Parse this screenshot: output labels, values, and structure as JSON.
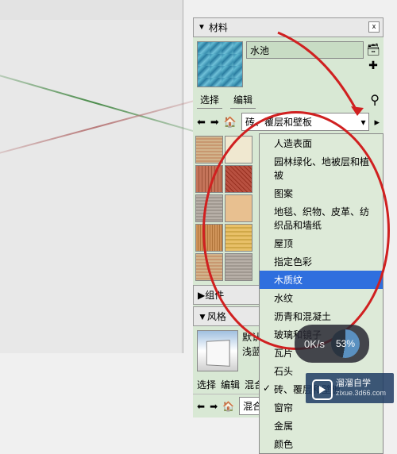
{
  "panel": {
    "title": "材料",
    "material_name": "水池",
    "tabs": {
      "select": "选择",
      "edit": "编辑"
    },
    "current_category": "砖、覆层和壁板"
  },
  "dropdown_items": [
    {
      "label": "人造表面"
    },
    {
      "label": "园林绿化、地被层和植被"
    },
    {
      "label": "图案"
    },
    {
      "label": "地毯、织物、皮革、纺织品和墙纸"
    },
    {
      "label": "屋顶"
    },
    {
      "label": "指定色彩"
    },
    {
      "label": "木质纹",
      "selected": true
    },
    {
      "label": "水纹"
    },
    {
      "label": "沥青和混凝土"
    },
    {
      "label": "玻璃和镜子"
    },
    {
      "label": "瓦片"
    },
    {
      "label": "石头"
    },
    {
      "label": "砖、覆层和壁板",
      "checked": true
    },
    {
      "label": "窗帘"
    },
    {
      "label": "金属"
    },
    {
      "label": "颜色"
    }
  ],
  "components": {
    "title": "组件"
  },
  "styles": {
    "title": "风格",
    "line1": "默认表面颜色",
    "line2": "浅蓝色天空",
    "tabs": {
      "select": "选择",
      "edit": "编辑",
      "mix": "混合"
    },
    "category": "混合风格"
  },
  "progress": {
    "speed": "0K/s",
    "percent": "53%"
  },
  "watermark": {
    "brand": "溜溜自学",
    "site": "zixue.3d66.com"
  }
}
